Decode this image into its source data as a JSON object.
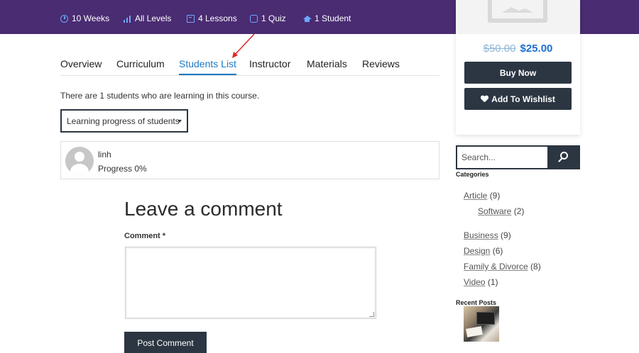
{
  "course_meta": {
    "duration": "10 Weeks",
    "level": "All Levels",
    "lessons": "4 Lessons",
    "quiz": "1 Quiz",
    "students": "1 Student"
  },
  "pricing": {
    "old_price": "$50.00",
    "new_price": "$25.00",
    "buy_label": "Buy Now",
    "wishlist_label": "Add To Wishlist"
  },
  "tabs": [
    {
      "label": "Overview"
    },
    {
      "label": "Curriculum"
    },
    {
      "label": "Students List",
      "active": true
    },
    {
      "label": "Instructor"
    },
    {
      "label": "Materials"
    },
    {
      "label": "Reviews"
    }
  ],
  "students_list": {
    "summary": "There are 1 students who are learning in this course.",
    "filter_selected": "Learning progress of students",
    "items": [
      {
        "name": "linh",
        "progress": "Progress 0%"
      }
    ]
  },
  "comment": {
    "title": "Leave a comment",
    "label": "Comment",
    "required_mark": "*",
    "submit_label": "Post Comment"
  },
  "sidebar": {
    "search_placeholder": "Search...",
    "categories_title": "Categories",
    "categories": [
      {
        "name": "Article",
        "count": "(9)"
      },
      {
        "name": "Software",
        "count": "(2)"
      },
      {
        "name": "Business",
        "count": "(9)"
      },
      {
        "name": "Design",
        "count": "(6)"
      },
      {
        "name": "Family & Divorce",
        "count": "(8)"
      },
      {
        "name": "Video",
        "count": "(1)"
      }
    ],
    "recent_posts_title": "Recent Posts"
  },
  "colors": {
    "topbar": "#4a2c72",
    "accent_blue": "#1e78c2",
    "dark_button": "#2c3642",
    "annotation_arrow": "#e0262a"
  }
}
